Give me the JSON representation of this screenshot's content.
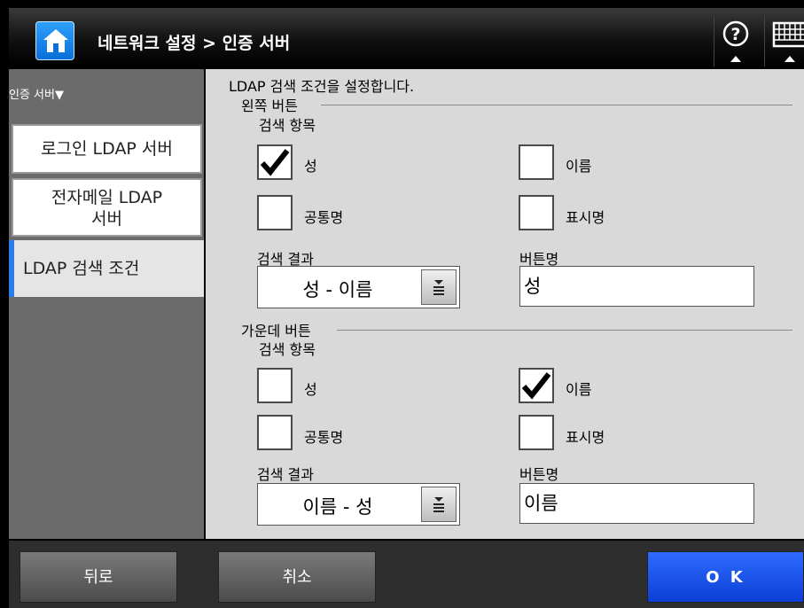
{
  "header": {
    "title": "네트워크 설정 > 인증 서버"
  },
  "icons": {
    "home": "home-icon",
    "help": "help-icon",
    "keyboard": "keyboard-icon"
  },
  "sidebar": {
    "section": "인증 서버▼",
    "items": [
      {
        "label": "로그인 LDAP 서버"
      },
      {
        "label_line1": "전자메일 LDAP",
        "label_line2": "서버"
      },
      {
        "label": "LDAP 검색 조건"
      }
    ]
  },
  "main": {
    "intro": "LDAP 검색 조건을 설정합니다.",
    "left": {
      "legend": "왼쪽 버튼",
      "items_label": "검색 항목",
      "checks": {
        "surname": "성",
        "given": "이름",
        "common": "공통명",
        "display": "표시명"
      },
      "checked": {
        "surname": true,
        "given": false,
        "common": false,
        "display": false
      },
      "result_label": "검색 결과",
      "result_value": "성 - 이름",
      "name_label": "버튼명",
      "name_value": "성"
    },
    "middle": {
      "legend": "가운데 버튼",
      "items_label": "검색 항목",
      "checks": {
        "surname": "성",
        "given": "이름",
        "common": "공통명",
        "display": "표시명"
      },
      "checked": {
        "surname": false,
        "given": true,
        "common": false,
        "display": false
      },
      "result_label": "검색 결과",
      "result_value": "이름 - 성",
      "name_label": "버튼명",
      "name_value": "이름"
    }
  },
  "footer": {
    "back": "뒤로",
    "cancel": "취소",
    "ok": "O K"
  },
  "colors": {
    "accent": "#2b7de9",
    "ok": "#0b3fd6"
  }
}
